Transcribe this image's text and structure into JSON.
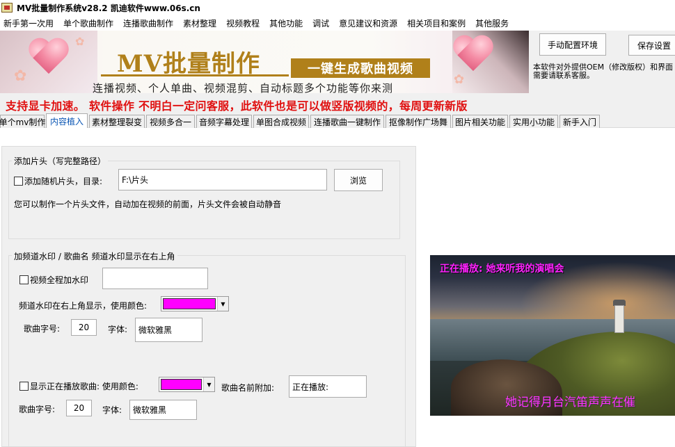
{
  "window": {
    "title": "MV批量制作系统v28.2 凯迪软件www.06s.cn"
  },
  "menu": {
    "items": [
      "新手第一次用",
      "单个歌曲制作",
      "连播歌曲制作",
      "素材整理",
      "视频教程",
      "其他功能",
      "调试",
      "意见建议和资源",
      "相关项目和案例",
      "其他服务"
    ]
  },
  "banner": {
    "title": "MV批量制作",
    "subtitle": "一键生成歌曲视频",
    "tagline": "连播视频、个人单曲、视频混剪、自动标题多个功能等你来测"
  },
  "toolbar": {
    "config_label": "手动配置环境",
    "save_label": "保存设置",
    "oem_note_line1": "本软件对外提供OEM（修改版权）和界面",
    "oem_note_line2": "需要请联系客服。"
  },
  "promo": {
    "text": "支持显卡加速。 软件操作 不明白一定问客服，此软件也是可以做竖版视频的，每周更新新版"
  },
  "tabs": [
    {
      "label": "单个mv制作",
      "active": false
    },
    {
      "label": "内容植入",
      "active": true
    },
    {
      "label": "素材整理裂变",
      "active": false
    },
    {
      "label": "视频多合一",
      "active": false
    },
    {
      "label": "音频字幕处理",
      "active": false
    },
    {
      "label": "单图合成视频",
      "active": false
    },
    {
      "label": "连播歌曲一键制作",
      "active": false
    },
    {
      "label": "抠像制作广场舞",
      "active": false
    },
    {
      "label": "图片相关功能",
      "active": false
    },
    {
      "label": "实用小功能",
      "active": false
    },
    {
      "label": "新手入门",
      "active": false
    }
  ],
  "intro": {
    "legend": "添加片头（写完整路径）",
    "random_label": "添加随机片头，目录:",
    "random_checked": false,
    "dir_value": "F:\\片头",
    "browse_label": "浏览",
    "hint": "您可以制作一个片头文件，自动加在视频的前面，片头文件会被自动静音"
  },
  "watermark": {
    "legend": "加频道水印  /   歌曲名      频道水印显示在右上角",
    "full_label": "视频全程加水印",
    "full_checked": false,
    "full_value": "",
    "corner_label": "频道水印在右上角显示，使用颜色:",
    "corner_color": "#ff00ff",
    "size_label": "歌曲字号:",
    "size_value": "20",
    "font_label": "字体:",
    "font_value": "微软雅黑",
    "now_label": "显示正在播放歌曲: 使用颜色:",
    "now_checked": false,
    "now_color": "#ff00ff",
    "prefix_label": "歌曲名前附加:",
    "prefix_value": "正在播放:",
    "size2_label": "歌曲字号:",
    "size2_value": "20",
    "font2_label": "字体:",
    "font2_value": "微软雅黑"
  },
  "preview": {
    "now_playing": "正在播放: 她来听我的演唱会",
    "lyric": "她记得月台汽笛声声在催"
  }
}
